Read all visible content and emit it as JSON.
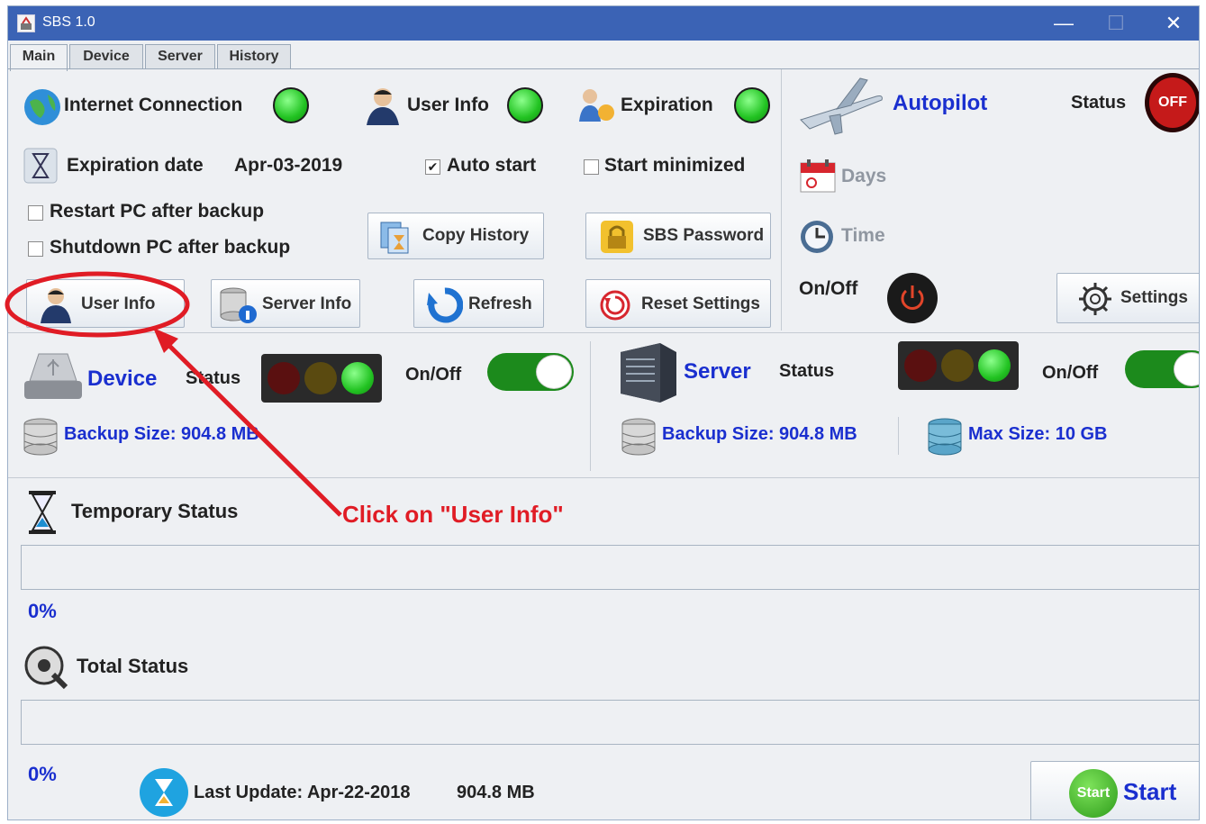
{
  "window": {
    "title": "SBS 1.0",
    "controls": [
      "—",
      "☐",
      "✕"
    ]
  },
  "tabs": [
    "Main",
    "Device",
    "Server",
    "History"
  ],
  "main": {
    "internet_connection": "Internet Connection",
    "user_info": "User Info",
    "expiration": "Expiration",
    "expiration_date_label": "Expiration date",
    "expiration_date_value": "Apr-03-2019",
    "auto_start": "Auto start",
    "auto_start_checked": true,
    "start_minimized": "Start minimized",
    "restart_pc": "Restart PC after backup",
    "shutdown_pc": "Shutdown PC after backup",
    "copy_history": "Copy History",
    "sbs_password": "SBS Password",
    "user_info_button": "User Info",
    "server_info_button": "Server Info",
    "refresh_button": "Refresh",
    "reset_settings_button": "Reset Settings"
  },
  "autopilot": {
    "title": "Autopilot",
    "status_label": "Status",
    "status_value": "OFF",
    "days": "Days",
    "time": "Time",
    "onoff": "On/Off",
    "settings": "Settings"
  },
  "device": {
    "title": "Device",
    "status_label": "Status",
    "onoff": "On/Off",
    "backup_size": "Backup Size:  904.8 MB"
  },
  "server": {
    "title": "Server",
    "status_label": "Status",
    "onoff": "On/Off",
    "backup_size": "Backup Size:  904.8 MB",
    "max_size": "Max Size: 10 GB"
  },
  "temporary_status": {
    "label": "Temporary Status",
    "percent": "0%",
    "progress": 0
  },
  "total_status": {
    "label": "Total Status",
    "percent": "0%",
    "progress": 0
  },
  "footer": {
    "last_update": "Last Update: Apr-22-2018",
    "size": "904.8 MB",
    "start_icon_text": "Start",
    "start_button": "Start"
  },
  "annotation": {
    "text": "Click on \"User Info\""
  },
  "colors": {
    "accent_blue": "#1a2fcf",
    "title_bar": "#3b63b5",
    "annotation_red": "#e01c25",
    "led_green": "#22c322"
  }
}
